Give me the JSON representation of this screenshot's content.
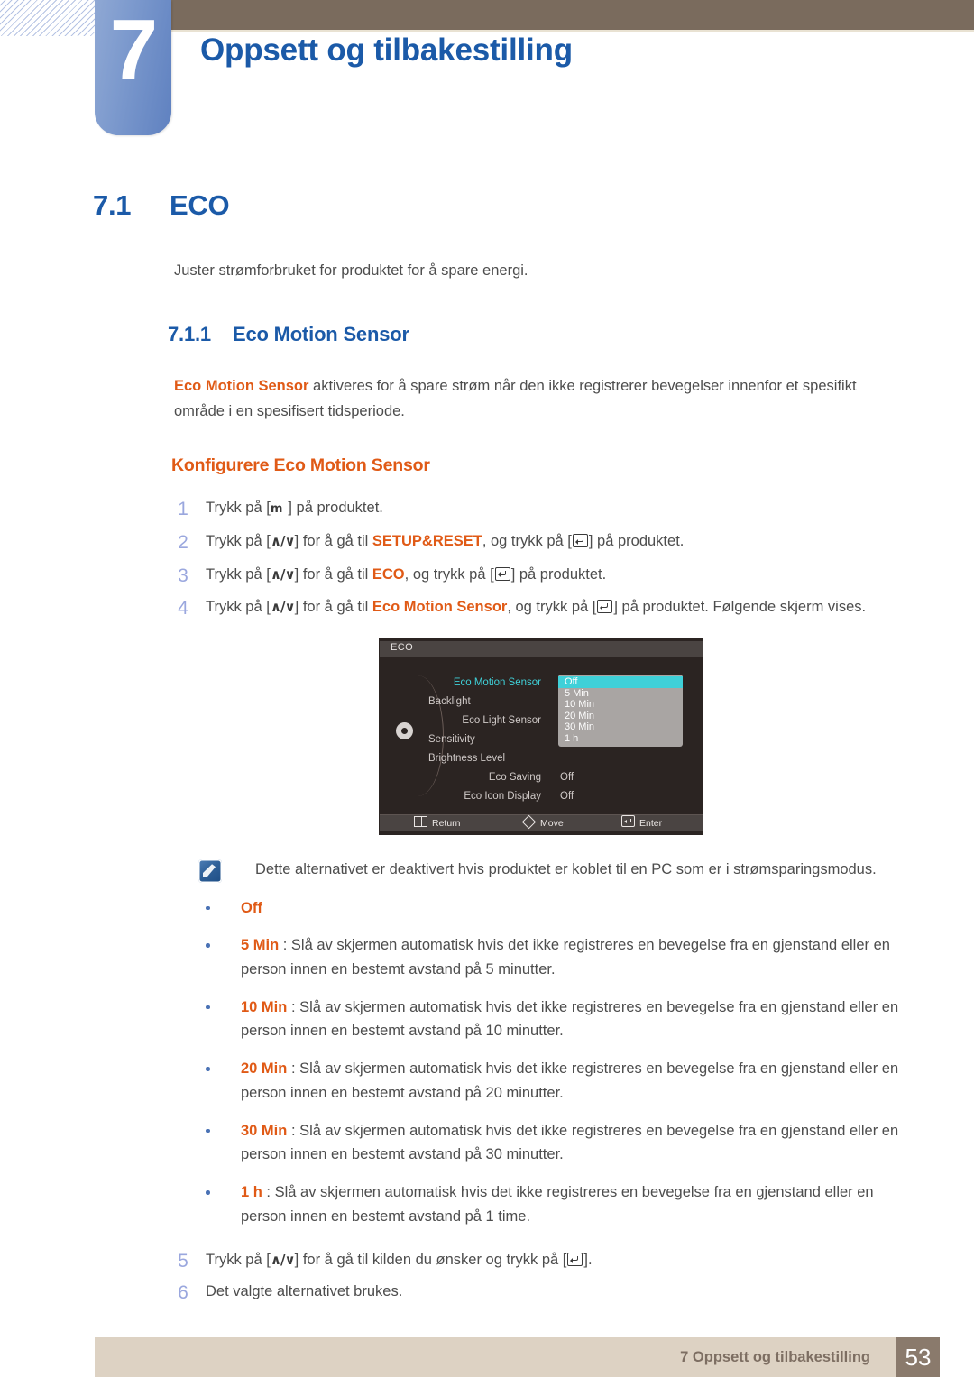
{
  "header": {
    "chapter_number": "7",
    "chapter_title": "Oppsett og tilbakestilling",
    "accent_blue": "#1b5aa8",
    "bar_brown": "#7a6b5d"
  },
  "section": {
    "number": "7.1",
    "title": "ECO",
    "intro": "Juster strømforbruket for produktet for å spare energi."
  },
  "subsection": {
    "number": "7.1.1",
    "title": "Eco Motion Sensor",
    "lead_term": "Eco Motion Sensor",
    "lead_rest": " aktiveres for å spare strøm når den ikke registrerer bevegelser innenfor et spesifikt område i en spesifisert tidsperiode."
  },
  "procedure": {
    "heading": "Konfigurere Eco Motion Sensor",
    "steps": [
      {
        "num": "1",
        "parts": [
          {
            "t": "text",
            "v": "Trykk på ["
          },
          {
            "t": "key-m",
            "v": "m"
          },
          {
            "t": "text",
            "v": "] på produktet."
          }
        ]
      },
      {
        "num": "2",
        "parts": [
          {
            "t": "text",
            "v": "Trykk på ["
          },
          {
            "t": "key-ud",
            "v": "∧/∨"
          },
          {
            "t": "text",
            "v": "] for å gå til "
          },
          {
            "t": "orange",
            "v": "SETUP&RESET"
          },
          {
            "t": "text",
            "v": ", og trykk på ["
          },
          {
            "t": "key-enter",
            "v": ""
          },
          {
            "t": "text",
            "v": "] på produktet."
          }
        ]
      },
      {
        "num": "3",
        "parts": [
          {
            "t": "text",
            "v": "Trykk på ["
          },
          {
            "t": "key-ud",
            "v": "∧/∨"
          },
          {
            "t": "text",
            "v": "] for å gå til "
          },
          {
            "t": "orange",
            "v": "ECO"
          },
          {
            "t": "text",
            "v": ", og trykk på ["
          },
          {
            "t": "key-enter",
            "v": ""
          },
          {
            "t": "text",
            "v": "] på produktet."
          }
        ]
      },
      {
        "num": "4",
        "parts": [
          {
            "t": "text",
            "v": "Trykk på ["
          },
          {
            "t": "key-ud",
            "v": "∧/∨"
          },
          {
            "t": "text",
            "v": "] for å gå til "
          },
          {
            "t": "orange",
            "v": "Eco Motion Sensor"
          },
          {
            "t": "text",
            "v": ", og trykk på ["
          },
          {
            "t": "key-enter",
            "v": ""
          },
          {
            "t": "text",
            "v": "] på produktet. Følgende skjerm vises."
          }
        ]
      }
    ],
    "steps_tail": [
      {
        "num": "5",
        "parts": [
          {
            "t": "text",
            "v": "Trykk på ["
          },
          {
            "t": "key-ud",
            "v": "∧/∨"
          },
          {
            "t": "text",
            "v": "] for å gå til kilden du ønsker og trykk på ["
          },
          {
            "t": "key-enter",
            "v": ""
          },
          {
            "t": "text",
            "v": "]."
          }
        ]
      },
      {
        "num": "6",
        "parts": [
          {
            "t": "text",
            "v": "Det valgte alternativet brukes."
          }
        ]
      }
    ]
  },
  "osd": {
    "title": "ECO",
    "menu_items": [
      {
        "label": "Eco Motion Sensor",
        "selected": true,
        "indent": 0,
        "value": ""
      },
      {
        "label": "Backlight",
        "selected": false,
        "indent": 1,
        "value": ""
      },
      {
        "label": "Eco Light Sensor",
        "selected": false,
        "indent": 0,
        "value": ""
      },
      {
        "label": "Sensitivity",
        "selected": false,
        "indent": 1,
        "value": ""
      },
      {
        "label": "Brightness Level",
        "selected": false,
        "indent": 1,
        "value": ""
      },
      {
        "label": "Eco Saving",
        "selected": false,
        "indent": 0,
        "value": "Off"
      },
      {
        "label": "Eco Icon Display",
        "selected": false,
        "indent": 0,
        "value": "Off"
      }
    ],
    "dropdown": {
      "options": [
        "Off",
        "5 Min",
        "10 Min",
        "20 Min",
        "30 Min",
        "1 h"
      ],
      "highlighted": "Off",
      "highlight_color": "#3fd0d8"
    },
    "footer": [
      {
        "icon": "return-icon",
        "label": "Return"
      },
      {
        "icon": "move-icon",
        "label": "Move"
      },
      {
        "icon": "enter-icon",
        "label": "Enter"
      }
    ]
  },
  "note": {
    "icon": "note-pencil-icon",
    "text": "Dette alternativet er deaktivert hvis produktet er koblet til en PC som er i strømsparingsmodus."
  },
  "bullets": [
    {
      "term": "Off",
      "rest": ""
    },
    {
      "term": "5 Min",
      "rest": " : Slå av skjermen automatisk hvis det ikke registreres en bevegelse fra en gjenstand eller en person innen en bestemt avstand på 5 minutter."
    },
    {
      "term": "10 Min",
      "rest": " : Slå av skjermen automatisk hvis det ikke registreres en bevegelse fra en gjenstand eller en person innen en bestemt avstand på 10 minutter."
    },
    {
      "term": "20 Min",
      "rest": " : Slå av skjermen automatisk hvis det ikke registreres en bevegelse fra en gjenstand eller en person innen en bestemt avstand på 20 minutter."
    },
    {
      "term": "30 Min",
      "rest": " : Slå av skjermen automatisk hvis det ikke registreres en bevegelse fra en gjenstand eller en person innen en bestemt avstand på 30 minutter."
    },
    {
      "term": "1 h",
      "rest": " : Slå av skjermen automatisk hvis det ikke registreres en bevegelse fra en gjenstand eller en person innen en bestemt avstand på 1 time."
    }
  ],
  "footer": {
    "text": "7 Oppsett og tilbakestilling",
    "page_number": "53",
    "band_color": "#ddd2c3",
    "page_box_color": "#8a7a6c"
  }
}
